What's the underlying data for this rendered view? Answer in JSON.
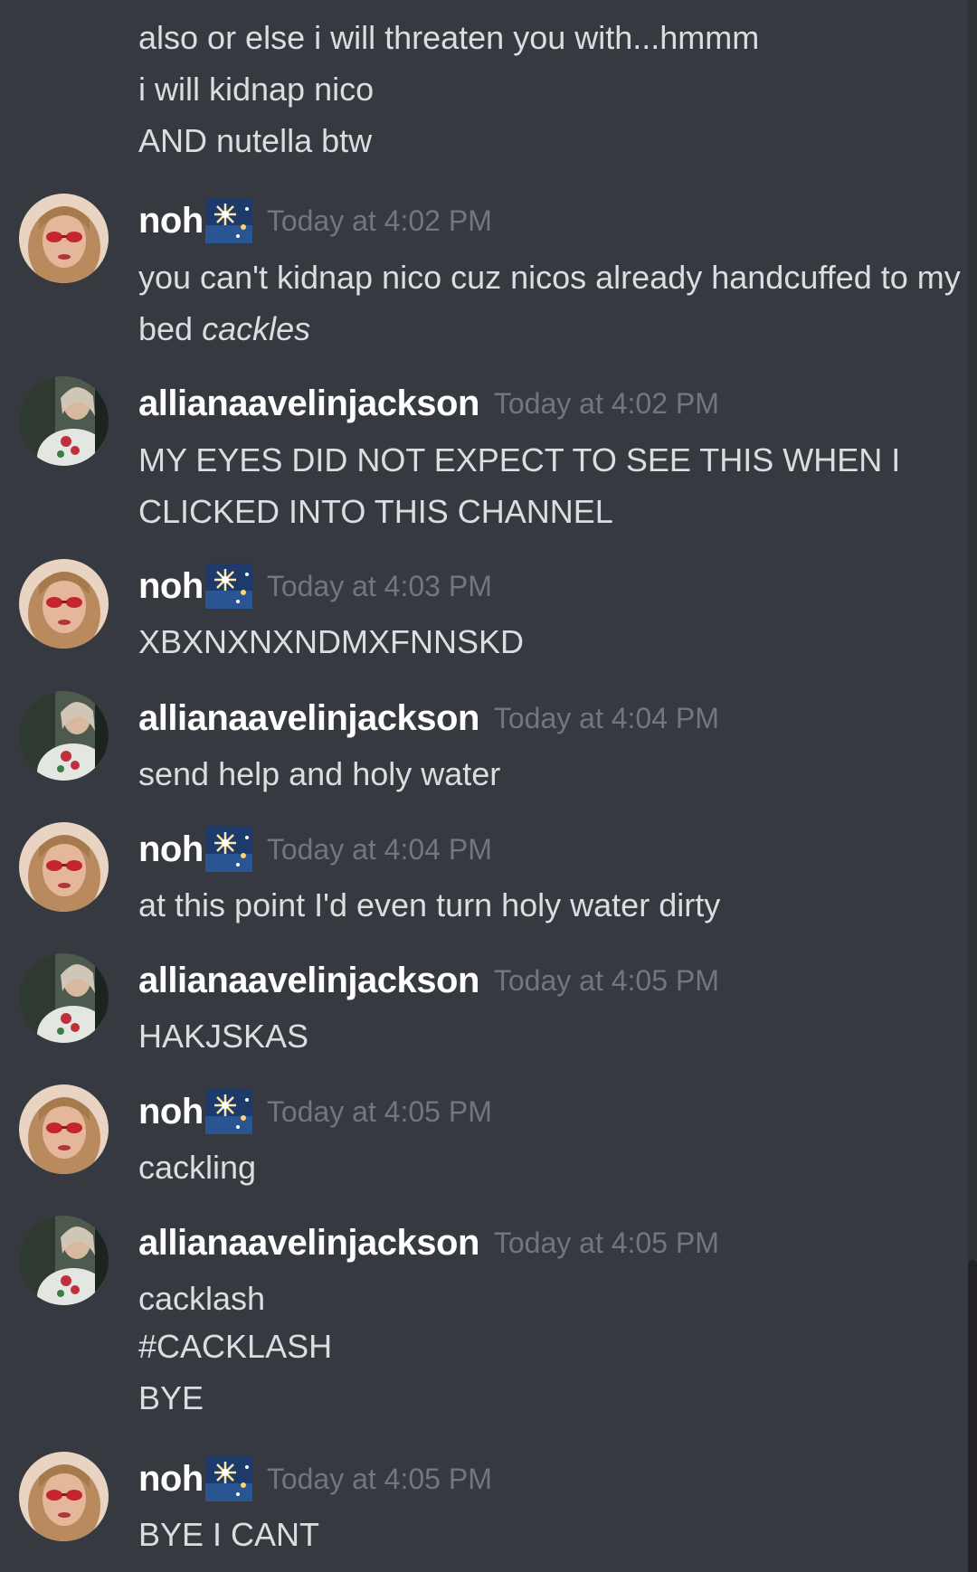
{
  "users": {
    "noh": {
      "name": "noh",
      "badge_icon": "fireworks-emoji-icon"
    },
    "allian": {
      "name": "allianaavelinjackson"
    }
  },
  "colors": {
    "background": "#36393f",
    "username": "#ffffff",
    "message_text": "#dcddde",
    "timestamp": "#72767d"
  },
  "top_lines": [
    "also or else i will threaten you with...hmmm",
    "i will kidnap nico",
    "AND nutella btw"
  ],
  "messages": [
    {
      "author": "noh",
      "timestamp": "Today at 4:02 PM",
      "lines": [
        "you can't kidnap nico cuz nicos already handcuffed to my bed",
        "cackles"
      ]
    },
    {
      "author": "allianaavelinjackson",
      "timestamp": "Today at 4:02 PM",
      "lines": [
        "MY EYES DID NOT EXPECT TO SEE THIS WHEN I CLICKED INTO THIS CHANNEL"
      ]
    },
    {
      "author": "noh",
      "timestamp": "Today at 4:03 PM",
      "lines": [
        "XBXNXNXNDMXFNNSKD"
      ]
    },
    {
      "author": "allianaavelinjackson",
      "timestamp": "Today at 4:04 PM",
      "lines": [
        "send help and holy water"
      ]
    },
    {
      "author": "noh",
      "timestamp": "Today at 4:04 PM",
      "lines": [
        "at this point I'd even turn holy water dirty"
      ]
    },
    {
      "author": "allianaavelinjackson",
      "timestamp": "Today at 4:05 PM",
      "lines": [
        "HAKJSKAS"
      ]
    },
    {
      "author": "noh",
      "timestamp": "Today at 4:05 PM",
      "lines": [
        "cackling"
      ]
    },
    {
      "author": "allianaavelinjackson",
      "timestamp": "Today at 4:05 PM",
      "lines": [
        "cacklash",
        "#CACKLASH",
        "BYE"
      ]
    },
    {
      "author": "noh",
      "timestamp": "Today at 4:05 PM",
      "lines": [
        "BYE I CANT"
      ]
    }
  ]
}
